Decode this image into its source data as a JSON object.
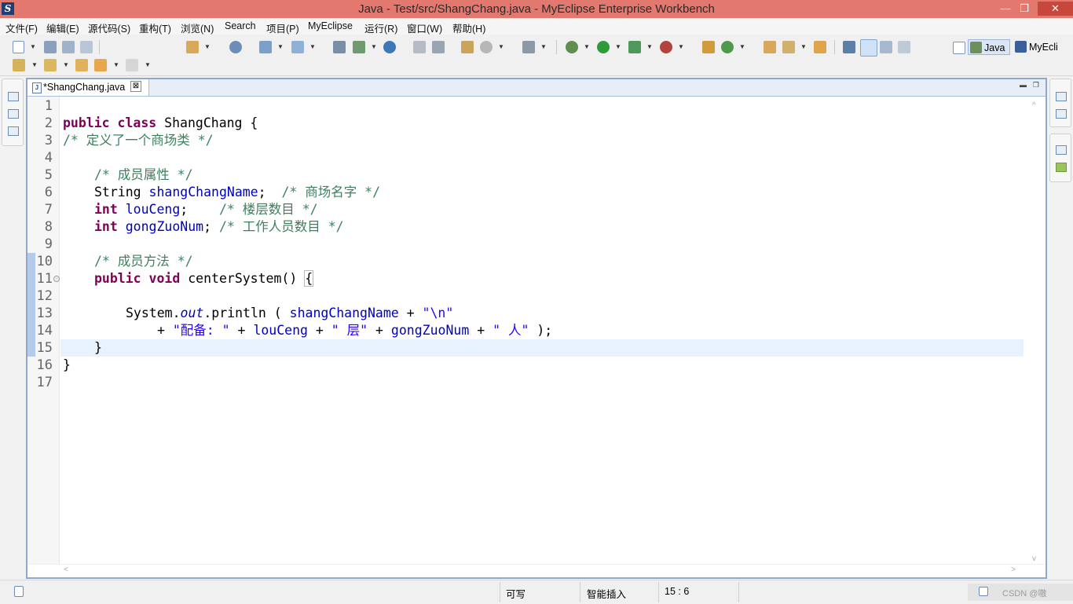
{
  "window": {
    "title": "Java  -  Test/src/ShangChang.java  -  MyEclipse Enterprise Workbench",
    "minimize": "—",
    "restore": "❐",
    "close": "✕"
  },
  "menu": [
    "文件(F)",
    "编辑(E)",
    "源代码(S)",
    "重构(T)",
    "浏览(N)",
    "Search",
    "项目(P)",
    "MyEclipse",
    "运行(R)",
    "窗口(W)",
    "帮助(H)"
  ],
  "perspectives": {
    "java": "Java",
    "myeclipse": "MyEcli"
  },
  "editor": {
    "tab_label": "*ShangChang.java",
    "tab_close": "⊠",
    "file_icon": "J",
    "lines": [
      "1",
      "2",
      "3",
      "4",
      "5",
      "6",
      "7",
      "8",
      "9",
      "10",
      "11",
      "12",
      "13",
      "14",
      "15",
      "16",
      "17"
    ],
    "code": {
      "l2_kw": "public class",
      "l2_rest": " ShangChang {",
      "l3": "/* 定义了一个商场类 */",
      "l5": "/* 成员属性 */",
      "l6_type": "String ",
      "l6_field": "shangChangName",
      "l6_semi": ";",
      "l6_cm": "/* 商场名字 */",
      "l7_kw": "int",
      "l7_field": "louCeng",
      "l7_semi": ";",
      "l7_cm": "/* 楼层数目 */",
      "l8_kw": "int",
      "l8_field": "gongZuoNum",
      "l8_semi": ";",
      "l8_cm": "/* 工作人员数目 */",
      "l10": "/* 成员方法 */",
      "l11_kw": "public void",
      "l11_rest": " centerSystem() ",
      "l11_brace": "{",
      "l13_a": "System.",
      "l13_out": "out",
      "l13_b": ".println ( ",
      "l13_field": "shangChangName",
      "l13_c": " + ",
      "l13_str": "\"\\n\"",
      "l14_a": "+ ",
      "l14_s1": "\"配备: \"",
      "l14_p1": " + ",
      "l14_f1": "louCeng",
      "l14_p2": " + ",
      "l14_s2": "\" 层\"",
      "l14_p3": " + ",
      "l14_f2": "gongZuoNum",
      "l14_p4": " + ",
      "l14_s3": "\" 人\"",
      "l14_end": " );",
      "l15": "}",
      "l16": "}"
    }
  },
  "status": {
    "writable": "可写",
    "insert_mode": "智能插入",
    "position": "15 : 6",
    "watermark": "CSDN @嗷"
  }
}
